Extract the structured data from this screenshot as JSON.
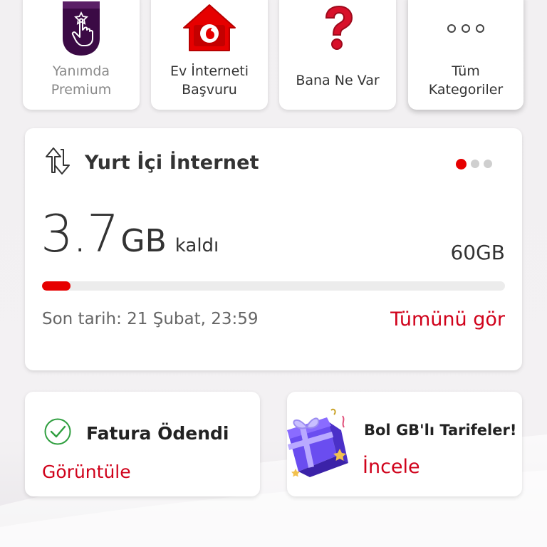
{
  "categories": [
    {
      "label": "Yanımda\nPremium",
      "icon": "premium-touch-icon"
    },
    {
      "label": "Ev İnterneti\nBaşvuru",
      "icon": "home-vodafone-icon"
    },
    {
      "label": "Bana Ne Var",
      "icon": "question-mark-icon"
    },
    {
      "label": "Tüm\nKategoriler",
      "icon": "more-dots-icon"
    }
  ],
  "internet": {
    "title": "Yurt İçi İnternet",
    "remaining_value": "3.7",
    "remaining_unit": "GB",
    "remaining_suffix": "kaldı",
    "total": "60GB",
    "usage_fraction": 0.062,
    "deadline": "Son tarih: 21 Şubat, 23:59",
    "see_all": "Tümünü gör",
    "carousel": {
      "pages": 3,
      "active": 0
    }
  },
  "bill": {
    "title": "Fatura Ödendi",
    "link": "Görüntüle",
    "icon": "check-circle-icon"
  },
  "promo": {
    "title": "Bol GB'lı Tarifeler!",
    "link": "İncele",
    "icon": "gift-box-icon"
  },
  "colors": {
    "accent": "#e60000",
    "link": "#d0021b",
    "success": "#2e9e3e",
    "premium": "#3b0a45"
  }
}
